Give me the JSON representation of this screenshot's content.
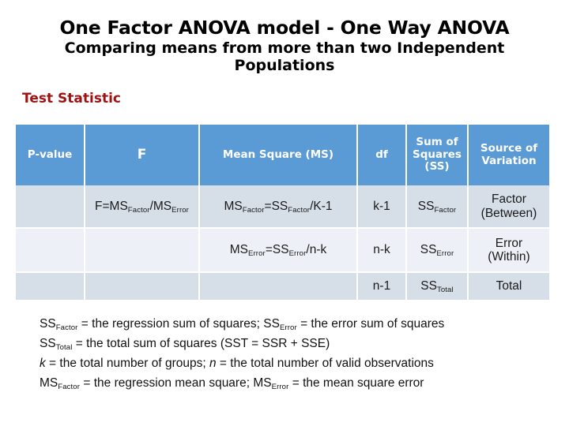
{
  "title": {
    "main": "One Factor ANOVA model - One Way ANOVA",
    "sub": "Comparing means from more than two Independent Populations"
  },
  "section": {
    "label": "Test Statistic",
    "label_color": "#9E1212"
  },
  "colors": {
    "header_blue": "#5B9BD5",
    "row_dark": "#D6DEE8",
    "row_light": "#EDF1F7",
    "gridline": "#FFFFFF"
  },
  "table": {
    "headers": [
      "P-value",
      "F",
      "Mean Square (MS)",
      "df",
      "Sum of Squares (SS)",
      "Source of Variation"
    ],
    "rows": [
      {
        "p_value": "",
        "f": {
          "pre": "F=MS",
          "sub1": "Factor",
          "mid": "/MS",
          "sub2": "Error"
        },
        "ms": {
          "pre": "MS",
          "sub1": "Factor",
          "mid": "=SS",
          "sub2": "Factor",
          "post": "/K-1"
        },
        "df": "k-1",
        "ss": {
          "pre": "SS",
          "sub1": "Factor"
        },
        "source_line1": "Factor",
        "source_line2": "(Between)"
      },
      {
        "p_value": "",
        "f": {
          "pre": "",
          "sub1": "",
          "mid": "",
          "sub2": ""
        },
        "ms": {
          "pre": "MS",
          "sub1": "Error",
          "mid": "=SS",
          "sub2": "Error",
          "post": "/n-k"
        },
        "df": "n-k",
        "ss": {
          "pre": "SS",
          "sub1": "Error"
        },
        "source_line1": "Error",
        "source_line2": "(Within)"
      },
      {
        "p_value": "",
        "f": {
          "pre": "",
          "sub1": "",
          "mid": "",
          "sub2": ""
        },
        "ms": {
          "pre": "",
          "sub1": "",
          "mid": "",
          "sub2": "",
          "post": ""
        },
        "df": "n-1",
        "ss": {
          "pre": "SS",
          "sub1": "Total"
        },
        "source_line1": "Total",
        "source_line2": ""
      }
    ]
  },
  "notes": {
    "line1_a": "SS",
    "line1_a_sub": "Factor",
    "line1_b": " = the regression sum of squares;  SS",
    "line1_c_sub": "Error",
    "line1_d": " = the error sum of squares",
    "line2_a": "SS",
    "line2_a_sub": "Total",
    "line2_b": " = the total sum of squares (SST = SSR + SSE)",
    "line3_k": "k",
    "line3_a": " = the total number of groups; ",
    "line3_n": "n",
    "line3_b": " = the total number of valid observations",
    "line4_a": "MS",
    "line4_a_sub": "Factor",
    "line4_b": " = the regression mean square; MS",
    "line4_c_sub": "Error",
    "line4_d": " = the mean square error"
  }
}
